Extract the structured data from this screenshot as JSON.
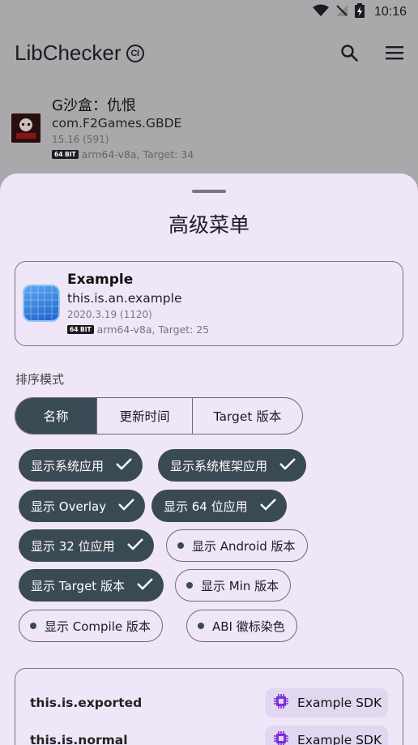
{
  "status_bar": {
    "time": "10:16"
  },
  "app_bar": {
    "title": "LibChecker",
    "badge": "CI"
  },
  "background_app": {
    "name": "G沙盒：仇恨",
    "package": "com.F2Games.GBDE",
    "version": "15.16 (591)",
    "bit_badge": "64 BIT",
    "abi_target": "arm64-v8a, Target: 34"
  },
  "sheet": {
    "title": "高级菜单",
    "example_app": {
      "name": "Example",
      "package": "this.is.an.example",
      "version": "2020.3.19 (1120)",
      "bit_badge": "64 BIT",
      "abi_target": "arm64-v8a, Target: 25"
    },
    "sort_label": "排序模式",
    "sort_options": [
      "名称",
      "更新时间",
      "Target 版本"
    ],
    "sort_selected": "名称",
    "options": [
      {
        "label": "显示系统应用",
        "checked": true
      },
      {
        "label": "显示系统框架应用",
        "checked": true
      },
      {
        "label": "显示 Overlay",
        "checked": true
      },
      {
        "label": "显示 64 位应用",
        "checked": true
      },
      {
        "label": "显示 32 位应用",
        "checked": true
      },
      {
        "label": "显示 Android 版本",
        "checked": false
      },
      {
        "label": "显示 Target 版本",
        "checked": true
      },
      {
        "label": "显示 Min 版本",
        "checked": false
      },
      {
        "label": "显示 Compile 版本",
        "checked": false
      },
      {
        "label": "ABI 徽标染色",
        "checked": false
      }
    ],
    "sdk_rows": [
      {
        "package": "this.is.exported",
        "sdk_label": "Example SDK"
      },
      {
        "package": "this.is.normal",
        "sdk_label": "Example SDK"
      }
    ]
  },
  "colors": {
    "scrim": "#a9a9ab",
    "sheet_bg": "#efe6f8",
    "chip_selected": "#3a4a55",
    "sdk_icon": "#7b2fd6"
  }
}
